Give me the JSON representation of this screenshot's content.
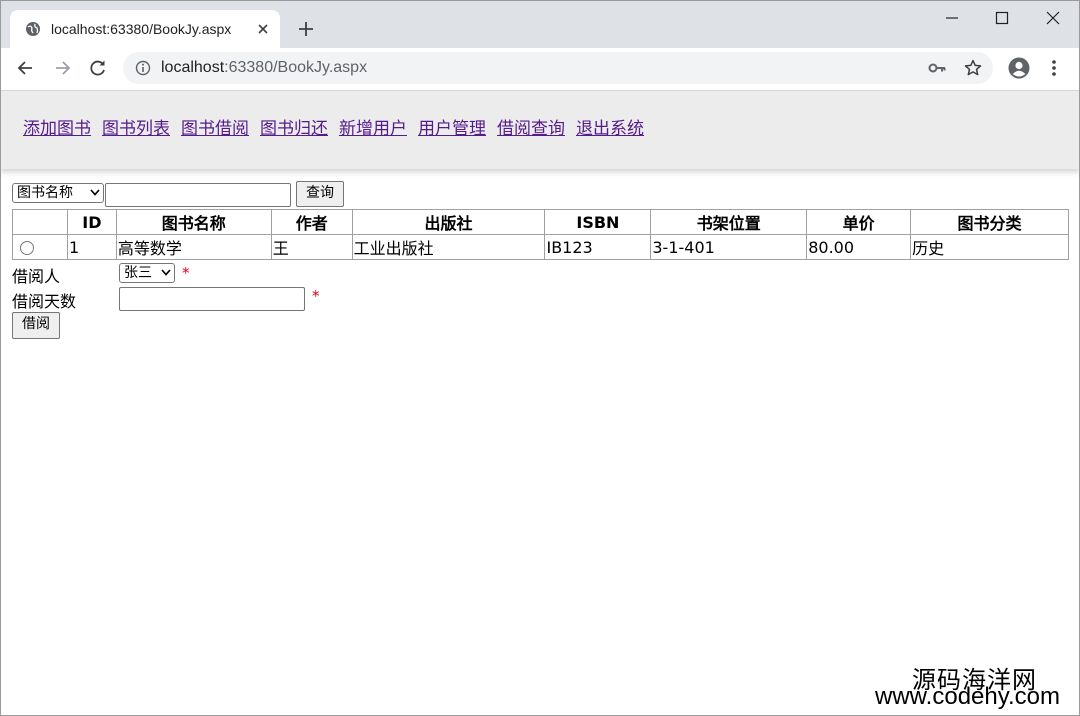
{
  "browser": {
    "tab_title": "localhost:63380/BookJy.aspx",
    "url_host": "localhost",
    "url_rest": ":63380/BookJy.aspx"
  },
  "nav": {
    "links": [
      "添加图书",
      "图书列表",
      "图书借阅",
      "图书归还",
      "新增用户",
      "用户管理",
      "借阅查询",
      "退出系统"
    ]
  },
  "search": {
    "field_selected": "图书名称",
    "query_value": "",
    "button_label": "查询"
  },
  "table": {
    "headers": [
      "",
      "ID",
      "图书名称",
      "作者",
      "出版社",
      "ISBN",
      "书架位置",
      "单价",
      "图书分类"
    ],
    "rows": [
      {
        "selected": false,
        "id": "1",
        "name": "高等数学",
        "author": "王",
        "publisher": "工业出版社",
        "isbn": "IB123",
        "shelf": "3-1-401",
        "price": "80.00",
        "category": "历史"
      }
    ]
  },
  "form": {
    "borrower_label": "借阅人",
    "borrower_selected": "张三",
    "days_label": "借阅天数",
    "days_value": "",
    "required_mark": "*",
    "submit_label": "借阅"
  },
  "watermark": {
    "line1": "源码海洋网",
    "line2": "www.codehy.com"
  },
  "icons": [
    "globe-icon",
    "close-icon",
    "plus-icon",
    "minimize-icon",
    "maximize-icon",
    "window-close-icon",
    "back-arrow-icon",
    "forward-arrow-icon",
    "reload-icon",
    "info-icon",
    "key-icon",
    "star-icon",
    "profile-icon",
    "menu-kebab-icon",
    "chevron-down-icon"
  ]
}
